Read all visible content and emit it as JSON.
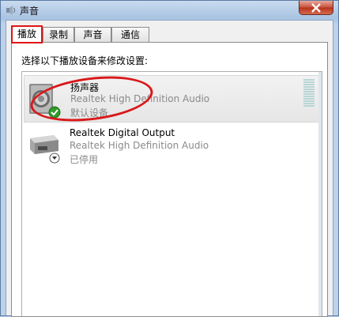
{
  "window": {
    "title": "声音"
  },
  "tabs": [
    {
      "label": "播放",
      "active": true
    },
    {
      "label": "录制",
      "active": false
    },
    {
      "label": "声音",
      "active": false
    },
    {
      "label": "通信",
      "active": false
    }
  ],
  "panel": {
    "instruction": "选择以下播放设备来修改设置:"
  },
  "devices": [
    {
      "name": "扬声器",
      "driver": "Realtek High Definition Audio",
      "status": "默认设备",
      "icon": "speaker-icon",
      "badge": "default-check-icon",
      "selected": true
    },
    {
      "name": "Realtek Digital Output",
      "driver": "Realtek High Definition Audio",
      "status": "已停用",
      "icon": "digital-output-icon",
      "badge": "disabled-down-arrow-icon",
      "selected": false
    }
  ],
  "colors": {
    "highlight_red": "#e01515",
    "close_red": "#c7503a"
  }
}
